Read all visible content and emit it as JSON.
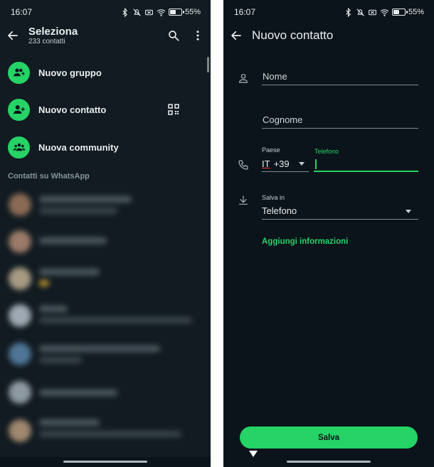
{
  "left": {
    "status": {
      "time": "16:07",
      "battery": "55%",
      "battery_level": 0.55
    },
    "appbar": {
      "title": "Seleziona",
      "subtitle": "233 contatti"
    },
    "actions": [
      {
        "label": "Nuovo gruppo",
        "icon": "group-add-icon"
      },
      {
        "label": "Nuovo contatto",
        "icon": "person-add-icon"
      },
      {
        "label": "Nuova community",
        "icon": "community-icon"
      }
    ],
    "section_header": "Contatti su WhatsApp"
  },
  "right": {
    "status": {
      "time": "16:07",
      "battery": "55%",
      "battery_level": 0.55
    },
    "appbar": {
      "title": "Nuovo contatto"
    },
    "form": {
      "name_placeholder": "Nome",
      "surname_placeholder": "Cognome",
      "country_label": "Paese",
      "country_code": "IT",
      "dial_code": "+39",
      "phone_label": "Telefono",
      "phone_value": "",
      "save_in_label": "Salva in",
      "save_in_value": "Telefono"
    },
    "add_info_link": "Aggiungi informazioni",
    "save_button": "Salva"
  },
  "colors": {
    "accent": "#25d366",
    "background": "#0b141a",
    "text": "#e9edef",
    "muted": "#8696a0"
  }
}
